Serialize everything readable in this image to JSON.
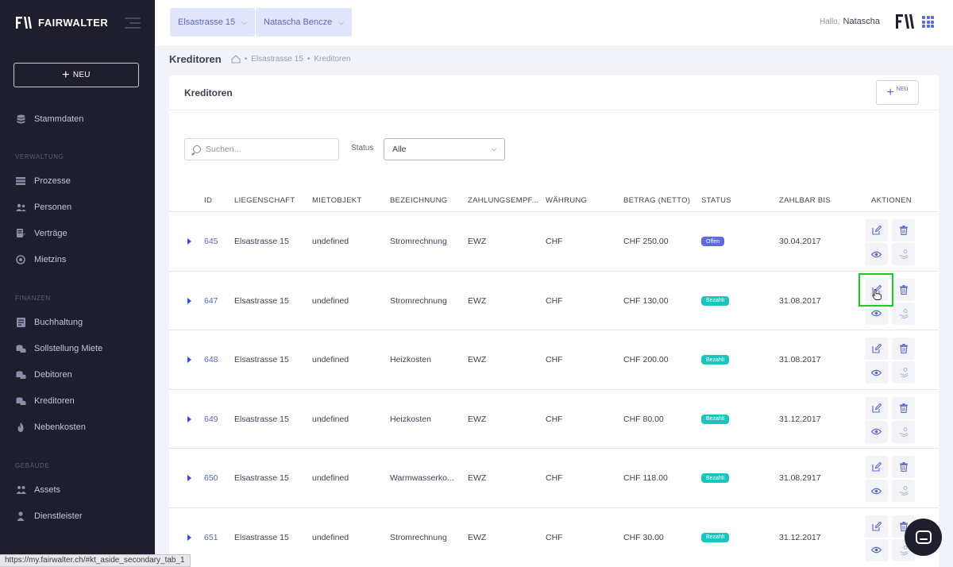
{
  "brand": {
    "name": "FAIRWALTER"
  },
  "sidebar": {
    "new_label": "NEU",
    "top_item": {
      "label": "Stammdaten",
      "icon": "database-icon"
    },
    "sections": [
      {
        "title": "VERWALTUNG",
        "items": [
          {
            "label": "Prozesse",
            "icon": "process-icon"
          },
          {
            "label": "Personen",
            "icon": "users-icon"
          },
          {
            "label": "Verträge",
            "icon": "contract-icon"
          },
          {
            "label": "Mietzins",
            "icon": "rent-icon"
          }
        ]
      },
      {
        "title": "FINANZEN",
        "items": [
          {
            "label": "Buchhaltung",
            "icon": "ledger-icon"
          },
          {
            "label": "Sollstellung Miete",
            "icon": "coins-icon"
          },
          {
            "label": "Debitoren",
            "icon": "coins-icon"
          },
          {
            "label": "Kreditoren",
            "icon": "coins-icon"
          },
          {
            "label": "Nebenkosten",
            "icon": "flame-icon"
          }
        ]
      },
      {
        "title": "GEBÄUDE",
        "items": [
          {
            "label": "Assets",
            "icon": "buildings-icon"
          },
          {
            "label": "Dienstleister",
            "icon": "person-icon"
          }
        ]
      }
    ]
  },
  "header": {
    "property_select": "Elsastrasse 15",
    "person_select": "Natascha Bencze",
    "greeting": "Hallo,",
    "user_name": "Natascha"
  },
  "subheader": {
    "title": "Kreditoren",
    "breadcrumb": [
      "Elsastrasse 15",
      "Kreditoren"
    ]
  },
  "card": {
    "title": "Kreditoren",
    "new_label": "NEU",
    "search_placeholder": "Suchen...",
    "status_label": "Status",
    "status_value": "Alle"
  },
  "table": {
    "columns": [
      "ID",
      "LIEGENSCHAFT",
      "MIETOBJEKT",
      "BEZEICHNUNG",
      "ZAHLUNGSEMPF...",
      "WÄHRUNG",
      "BETRAG (NETTO)",
      "STATUS",
      "ZAHLBAR BIS",
      "AKTIONEN"
    ],
    "rows": [
      {
        "id": "645",
        "property": "Elsastrasse 15",
        "object": "undefined",
        "description": "Stromrechnung",
        "payee": "EWZ",
        "currency": "CHF",
        "amount": "CHF 250.00",
        "status": "Offen",
        "due": "30.04.2017"
      },
      {
        "id": "647",
        "property": "Elsastrasse 15",
        "object": "undefined",
        "description": "Stromrechnung",
        "payee": "EWZ",
        "currency": "CHF",
        "amount": "CHF 130.00",
        "status": "Bezahlt",
        "due": "31.08.2017"
      },
      {
        "id": "648",
        "property": "Elsastrasse 15",
        "object": "undefined",
        "description": "Heizkosten",
        "payee": "EWZ",
        "currency": "CHF",
        "amount": "CHF 200.00",
        "status": "Bezahlt",
        "due": "31.08.2017"
      },
      {
        "id": "649",
        "property": "Elsastrasse 15",
        "object": "undefined",
        "description": "Heizkosten",
        "payee": "EWZ",
        "currency": "CHF",
        "amount": "CHF 80.00",
        "status": "Bezahlt",
        "due": "31.12.2017"
      },
      {
        "id": "650",
        "property": "Elsastrasse 15",
        "object": "undefined",
        "description": "Warmwasserko...",
        "payee": "EWZ",
        "currency": "CHF",
        "amount": "CHF 118.00",
        "status": "Bezahlt",
        "due": "31.08.2917"
      },
      {
        "id": "651",
        "property": "Elsastrasse 15",
        "object": "undefined",
        "description": "Stromrechnung",
        "payee": "EWZ",
        "currency": "CHF",
        "amount": "CHF 30.00",
        "status": "Bezahlt",
        "due": "31.12.2017"
      }
    ]
  },
  "browser_status_url": "https://my.fairwalter.ch/#kt_aside_secondary_tab_1",
  "colors": {
    "sidebar": "#1e1e2d",
    "accent": "#5b67c9",
    "open": "#5d6bdb",
    "paid": "#1bc5bd",
    "highlight": "#21c92a"
  }
}
